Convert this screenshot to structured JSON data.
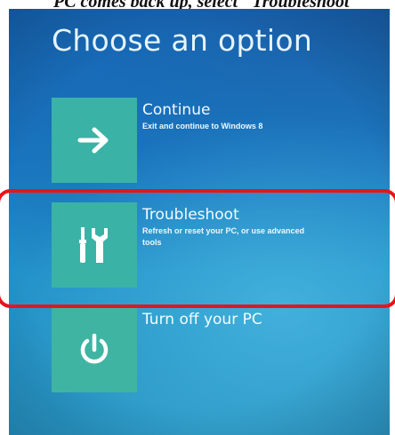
{
  "caption": {
    "text": "PC comes back up, select \"Troubleshoot\""
  },
  "screen": {
    "title": "Choose an option",
    "options": [
      {
        "label": "Continue",
        "description": "Exit and continue to Windows 8",
        "icon": "arrow-right-icon"
      },
      {
        "label": "Troubleshoot",
        "description": "Refresh or reset your PC, or use advanced tools",
        "icon": "tools-icon"
      },
      {
        "label": "Turn off your PC",
        "description": "",
        "icon": "power-icon"
      }
    ]
  },
  "annotation": {
    "highlight_color": "#e8141b",
    "highlighted_option": "Troubleshoot"
  },
  "colors": {
    "tile": "#3ab3a6",
    "background": "#1c79bf",
    "text": "#f2fbff"
  }
}
